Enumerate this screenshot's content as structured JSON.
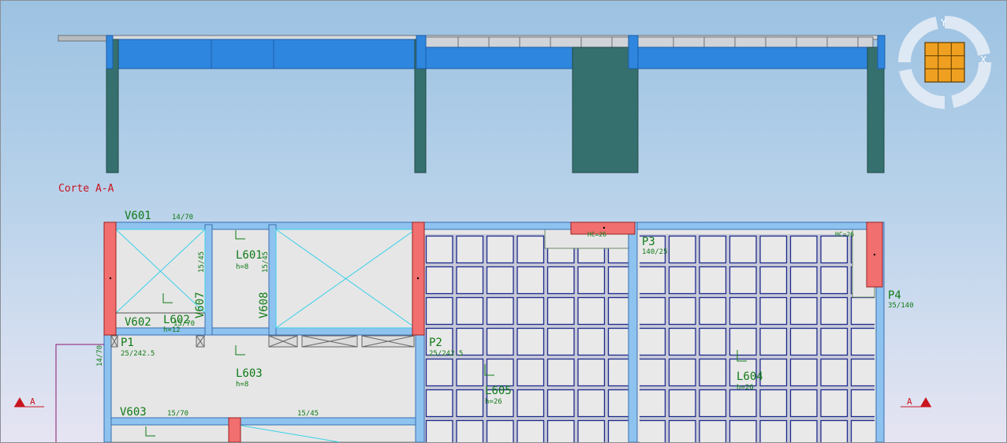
{
  "section": {
    "title": "Corte A-A"
  },
  "cut_marker": {
    "left": "A",
    "right": "A"
  },
  "view_cube": {
    "y_label": "Y",
    "x_label": "X",
    "icon": "view-cube-icon"
  },
  "colors": {
    "beam": "#2f86de",
    "column_section": "#35706e",
    "pillar_plan": "#f26f6f",
    "beam_plan": "#8ec3f0",
    "slab": "#e6e6e6",
    "label": "#0f7a16",
    "cut": "#c8141e",
    "cube": "#f0a020"
  },
  "beams": {
    "v601": {
      "name": "V601",
      "dim": "14/70"
    },
    "v602": {
      "name": "V602"
    },
    "v603": {
      "name": "V603",
      "dim": "15/70",
      "dim2": "15/45"
    },
    "v607": {
      "name": "V607",
      "dim": "15/45"
    },
    "v608": {
      "name": "V608",
      "dim": "15/45"
    },
    "left": {
      "dim": "14/70"
    }
  },
  "slabs": {
    "l601": {
      "name": "L601",
      "h": "h=8"
    },
    "l602": {
      "name": "L602",
      "h": "h=12",
      "dim": "15/70"
    },
    "l603": {
      "name": "L603",
      "h": "h=8"
    },
    "l604": {
      "name": "L604",
      "h": "h=26"
    },
    "l605": {
      "name": "L605",
      "h": "h=26"
    }
  },
  "pillars": {
    "p1": {
      "name": "P1",
      "dim": "25/242.5"
    },
    "p2": {
      "name": "P2",
      "dim": "25/242.5"
    },
    "p3": {
      "name": "P3",
      "dim": "140/25"
    },
    "p4": {
      "name": "P4",
      "dim": "35/140"
    }
  },
  "marks": {
    "hc1": "HC=26",
    "hc2": "HC=26"
  }
}
